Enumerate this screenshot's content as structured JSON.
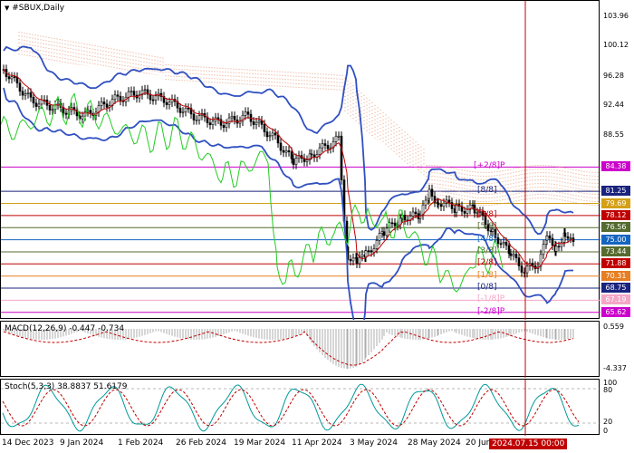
{
  "symbol_title": "#SBUX,Daily",
  "macd_title": "MACD(12,26,9) -0.447 -0.734",
  "stoch_title": "Stoch(5,3,3) 38.8837 51.6179",
  "price_axis": [
    {
      "label": "103.96",
      "price": 103.96
    },
    {
      "label": "100.12",
      "price": 100.12
    },
    {
      "label": "96.28",
      "price": 96.28
    },
    {
      "label": "92.44",
      "price": 92.44
    },
    {
      "label": "88.55",
      "price": 88.55
    }
  ],
  "price_tags": [
    {
      "label": "84.38",
      "price": 84.38,
      "color": "#cc00cc"
    },
    {
      "label": "81.25",
      "price": 81.25,
      "color": "#1a237e"
    },
    {
      "label": "79.69",
      "price": 79.69,
      "color": "#d4a017"
    },
    {
      "label": "78.12",
      "price": 78.12,
      "color": "#c00000"
    },
    {
      "label": "76.56",
      "price": 76.56,
      "color": "#556b2f"
    },
    {
      "label": "75.00",
      "price": 75.0,
      "color": "#1565c0"
    },
    {
      "label": "73.44",
      "price": 73.44,
      "color": "#556b2f"
    },
    {
      "label": "71.88",
      "price": 71.88,
      "color": "#c00000"
    },
    {
      "label": "70.31",
      "price": 70.31,
      "color": "#e67e22"
    },
    {
      "label": "68.75",
      "price": 68.75,
      "color": "#1a237e"
    },
    {
      "label": "67.19",
      "price": 67.19,
      "color": "#f4a6c6"
    },
    {
      "label": "65.62",
      "price": 65.62,
      "color": "#cc00cc"
    }
  ],
  "murrey_labels": [
    {
      "label": "[+2/8]P",
      "price": 84.38,
      "color": "#cc00cc"
    },
    {
      "label": "[8/8]",
      "price": 81.25,
      "color": "#1a237e"
    },
    {
      "label": "[6/8]",
      "price": 78.12,
      "color": "#c00000"
    },
    {
      "label": "[5/8]",
      "price": 76.56,
      "color": "#556b2f"
    },
    {
      "label": "[4/8]",
      "price": 75.0,
      "color": "#1565c0"
    },
    {
      "label": "[3/8]",
      "price": 73.44,
      "color": "#556b2f"
    },
    {
      "label": "[2/8]",
      "price": 71.88,
      "color": "#c00000"
    },
    {
      "label": "[1/8]",
      "price": 70.31,
      "color": "#e67e22"
    },
    {
      "label": "[0/8]",
      "price": 68.75,
      "color": "#1a237e"
    },
    {
      "label": "[-1/8]P",
      "price": 67.19,
      "color": "#f4a6c6"
    },
    {
      "label": "[-2/8]P",
      "price": 65.62,
      "color": "#cc00cc"
    }
  ],
  "macd_axis": [
    "0.559",
    "-4.337"
  ],
  "stoch_axis": [
    "100",
    "80",
    "20",
    "0"
  ],
  "time_axis": [
    "14 Dec 2023",
    "9 Jan 2024",
    "1 Feb 2024",
    "26 Feb 2024",
    "19 Mar 2024",
    "11 Apr 2024",
    "3 May 2024",
    "28 May 2024",
    "20 Jun"
  ],
  "time_axis_tail": "4",
  "date_marker": "2024.07.15 00:00",
  "colors": {
    "candles": "#000000",
    "bollinger": "#3050c0",
    "moving_average": "#c00000",
    "chikou": "#22cc22",
    "ichimoku_cloud": "#e8a080",
    "vertical_marker": "#c00000"
  }
}
